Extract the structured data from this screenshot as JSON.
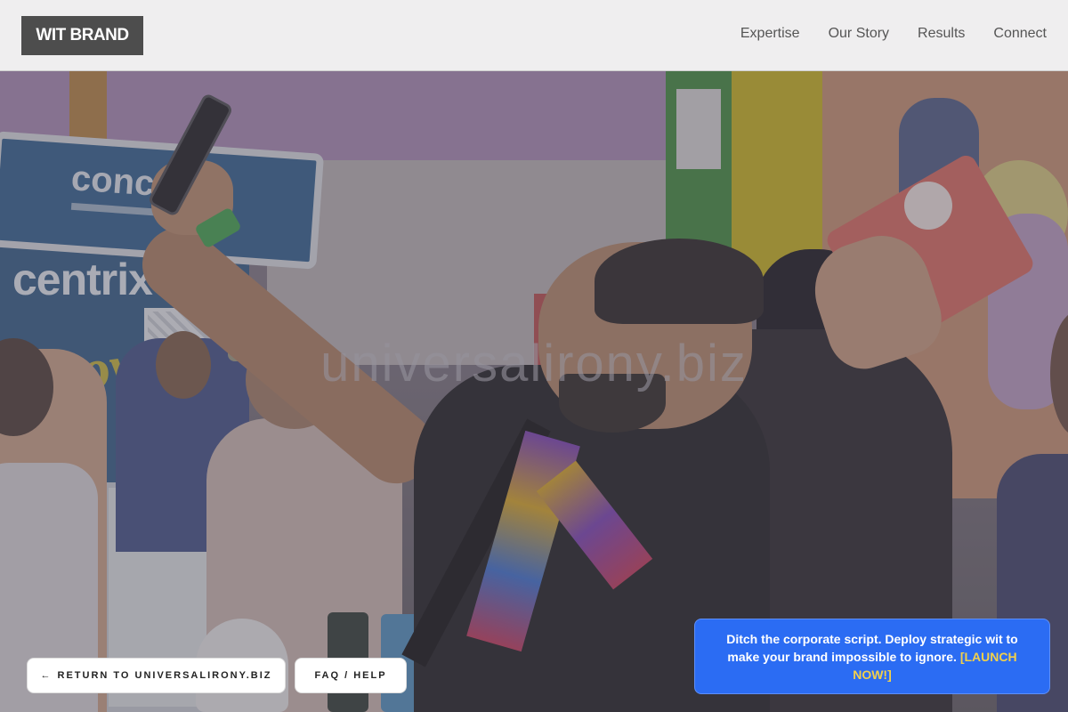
{
  "header": {
    "brand": "WIT BRAND",
    "nav": [
      "Expertise",
      "Our Story",
      "Results",
      "Connect"
    ]
  },
  "hero": {
    "watermark": "universalirony.biz",
    "booth_sign": "concen",
    "booth_brand": "centrix",
    "booth_script": "Love!"
  },
  "buttons": {
    "return_arrow": "←",
    "return_label": "RETURN TO UNIVERSALIRONY.BIZ",
    "faq_label": "FAQ / HELP"
  },
  "promo": {
    "text": "Ditch the corporate script. Deploy strategic wit to make your brand impossible to ignore.",
    "cta": "[LAUNCH NOW!]"
  },
  "colors": {
    "promo_bg": "#2b6cf3",
    "cta_yellow": "#f2d04b",
    "brand_bg": "#4d4d4d"
  }
}
